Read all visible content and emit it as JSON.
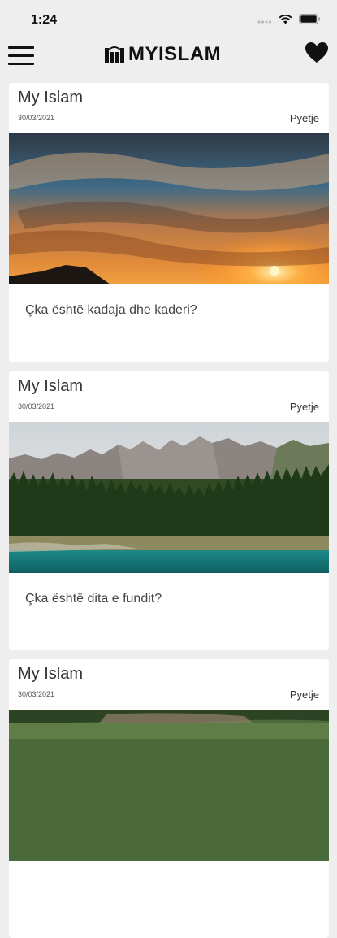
{
  "status": {
    "time": "1:24"
  },
  "header": {
    "logo_text": "MYISLAM",
    "colors": {
      "icon": "#111111"
    }
  },
  "posts": [
    {
      "source": "My Islam",
      "date": "30/03/2021",
      "category": "Pyetje",
      "title": "Çka është kadaja dhe kaderi?",
      "image": "sunset-sky-photo"
    },
    {
      "source": "My Islam",
      "date": "30/03/2021",
      "category": "Pyetje",
      "title": "Çka është dita e fundit?",
      "image": "mountain-lake-photo"
    },
    {
      "source": "My Islam",
      "date": "30/03/2021",
      "category": "Pyetje",
      "title": "",
      "image": "forest-river-photo"
    }
  ]
}
